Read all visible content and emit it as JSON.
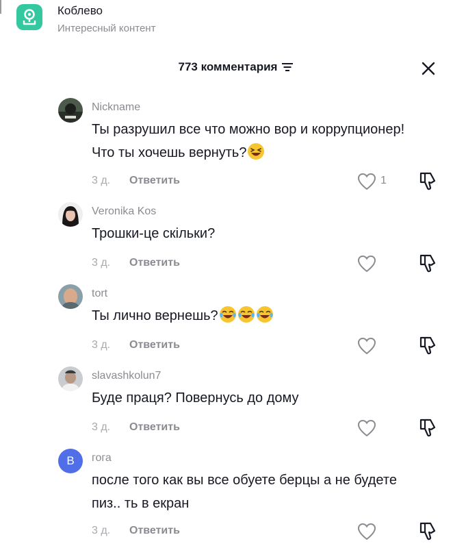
{
  "app": {
    "title": "Коблево",
    "subtitle": "Интересный контент",
    "logo_icon": "map-pin-icon",
    "accent": "#33c8a0"
  },
  "header": {
    "comment_count": "773 комментария",
    "filter_icon": "filter-lines-icon",
    "close_icon": "close-icon"
  },
  "comments": [
    {
      "username": "Nickname",
      "text": "Ты разрушил все что можно вор и коррупционер! Что ты хочешь вернуть?",
      "emoji": [
        "laughing-squint-emoji"
      ],
      "time": "3 д.",
      "reply_label": "Ответить",
      "likes": "1",
      "avatar_color": "#3a4a3a"
    },
    {
      "username": "Veronika Kos",
      "text": "Трошки-це скільки?",
      "emoji": [],
      "time": "3 д.",
      "reply_label": "Ответить",
      "likes": "",
      "avatar_color": "#1e1a1e"
    },
    {
      "username": "tort",
      "text": "Ты лично вернешь?",
      "emoji": [
        "tears-of-joy-emoji",
        "tears-of-joy-emoji",
        "tears-of-joy-emoji"
      ],
      "time": "3 д.",
      "reply_label": "Ответить",
      "likes": "",
      "avatar_color": "#9a8070"
    },
    {
      "username": "slavashkolun7",
      "text": "Буде праця? Повернусь до дому",
      "emoji": [],
      "time": "3 д.",
      "reply_label": "Ответить",
      "likes": "",
      "avatar_color": "#8a8e94"
    },
    {
      "username": "гога",
      "text": "после того как вы все обуете берцы а не будете пиз.. ть в екран",
      "emoji": [],
      "time": "3 д.",
      "reply_label": "Ответить",
      "likes": "",
      "avatar_letter": "В",
      "avatar_color": "#4f6ee8"
    }
  ]
}
